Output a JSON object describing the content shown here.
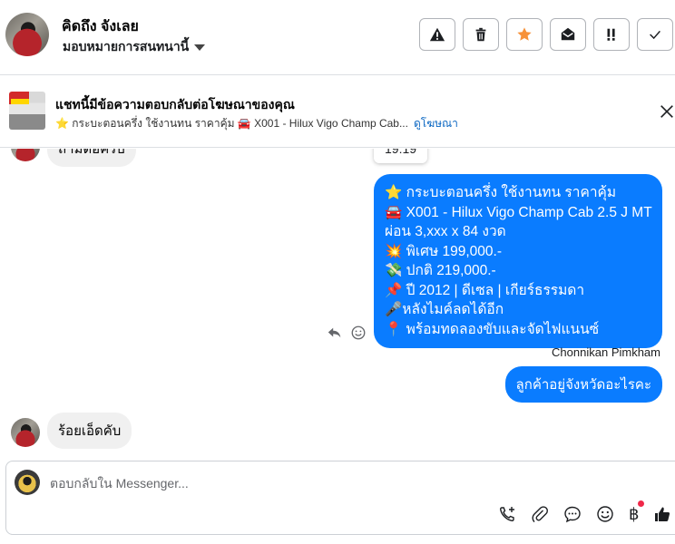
{
  "header": {
    "name": "คิดถึง จังเลย",
    "assign_label": "มอบหมายการสนทนานี้",
    "actions": [
      "report",
      "delete",
      "star",
      "mark-unread",
      "important",
      "done"
    ]
  },
  "ad_banner": {
    "title": "แชทนี้มีข้อความตอบกลับต่อโฆษณาของคุณ",
    "subtitle": "⭐ กระบะตอนครึ่ง ใช้งานทน ราคาคุ้ม 🚘 X001 - Hilux Vigo Champ Cab...",
    "link": "ดูโฆษณา"
  },
  "conversation": {
    "partial_message": "ถามต่อครับ",
    "timestamp": "19:19",
    "outgoing_lines": [
      "⭐ กระบะตอนครึ่ง ใช้งานทน ราคาคุ้ม",
      "🚘 X001 - Hilux Vigo Champ Cab 2.5 J MT",
      "ผ่อน 3,xxx x 84 งวด",
      "💥 พิเศษ 199,000.-",
      "💸 ปกติ 219,000.-",
      "📌 ปี 2012 | ดีเซล | เกียร์ธรรมดา",
      "🎤หลังไมค์ลดได้อีก",
      "📍 พร้อมทดลองขับและจัดไฟแนนซ์"
    ],
    "sender_name": "Chonnikan Pimkham",
    "outgoing_short": "ลูกค้าอยู่จังหวัดอะไรคะ",
    "incoming_reply": "ร้อยเอ็ดคับ"
  },
  "composer": {
    "placeholder": "ตอบกลับใน Messenger...",
    "baht_symbol": "฿"
  }
}
